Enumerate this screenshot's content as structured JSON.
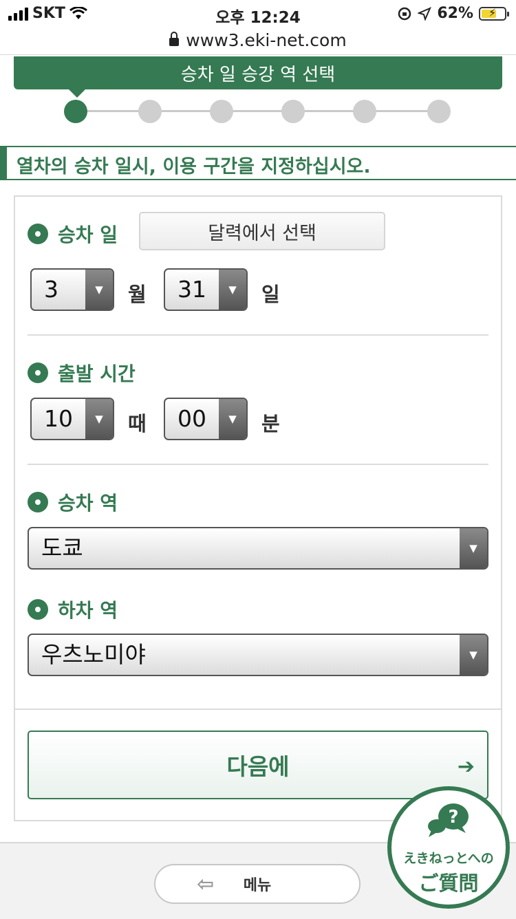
{
  "status_bar": {
    "carrier": "SKT",
    "time": "오후 12:24",
    "battery": "62%"
  },
  "browser": {
    "url": "www3.eki-net.com"
  },
  "header": {
    "step_title": "승차 일 승강 역 선택",
    "current_step": 1,
    "total_steps": 6
  },
  "section_title": "열차의 승차 일시, 이용 구간을 지정하십시오.",
  "form": {
    "date": {
      "label": "승차 일",
      "calendar_button": "달력에서 선택",
      "month": "3",
      "month_unit": "월",
      "day": "31",
      "day_unit": "일"
    },
    "time": {
      "label": "출발 시간",
      "hour": "10",
      "hour_unit": "때",
      "minute": "00",
      "minute_unit": "분"
    },
    "departure": {
      "label": "승차 역",
      "value": "도쿄"
    },
    "arrival": {
      "label": "하차 역",
      "value": "우츠노미야"
    },
    "next_button": "다음에"
  },
  "footer": {
    "menu_label": "메뉴"
  },
  "faq": {
    "line1": "えきねっとへの",
    "line2": "ご質問"
  },
  "colors": {
    "accent": "#357a52",
    "inactive_step": "#cfcfcf"
  }
}
